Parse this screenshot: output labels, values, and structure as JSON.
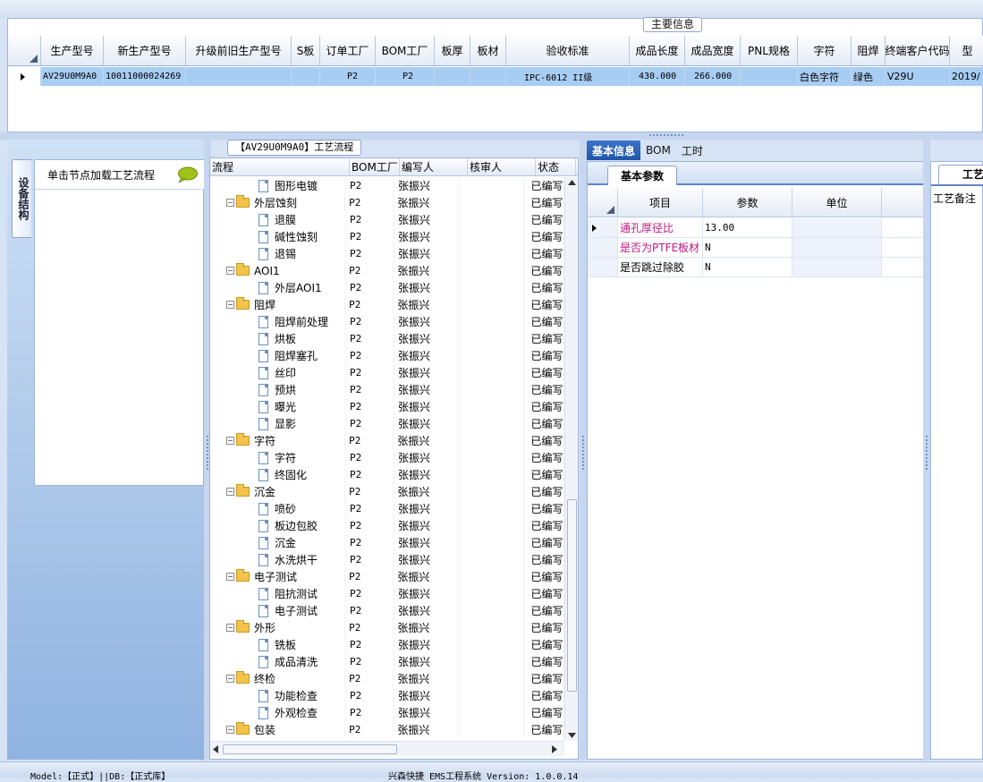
{
  "main_grid": {
    "group_title": "主要信息",
    "columns": [
      "生产型号",
      "新生产型号",
      "升级前旧生产型号",
      "S板",
      "订单工厂",
      "BOM工厂",
      "板厚",
      "板材",
      "验收标准",
      "成品长度",
      "成品宽度",
      "PNL规格",
      "字符",
      "阻焊",
      "终端客户代码",
      "型"
    ],
    "row": [
      "AV29U0M9A0",
      "10011000024269",
      "",
      "",
      "P2",
      "P2",
      "",
      "",
      "IPC-6012 II级",
      "430.000",
      "266.000",
      "",
      "白色字符",
      "绿色",
      "V29U",
      "2019/"
    ]
  },
  "left_panel": {
    "vertical_tab": "设备结构",
    "title": "单击节点加载工艺流程"
  },
  "process_panel": {
    "title": "【AV29U0M9A0】工艺流程",
    "columns": [
      "流程",
      "BOM工厂",
      "编写人",
      "核审人",
      "状态"
    ],
    "rows": [
      {
        "level": 2,
        "kind": "file",
        "name": "图形电镀",
        "factory": "P2",
        "author": "张振兴",
        "status": "已编写"
      },
      {
        "level": 1,
        "kind": "folder",
        "name": "外层蚀刻",
        "factory": "P2",
        "author": "张振兴",
        "status": "已编写"
      },
      {
        "level": 2,
        "kind": "file",
        "name": "退膜",
        "factory": "P2",
        "author": "张振兴",
        "status": "已编写"
      },
      {
        "level": 2,
        "kind": "file",
        "name": "碱性蚀刻",
        "factory": "P2",
        "author": "张振兴",
        "status": "已编写"
      },
      {
        "level": 2,
        "kind": "file",
        "name": "退锡",
        "factory": "P2",
        "author": "张振兴",
        "status": "已编写"
      },
      {
        "level": 1,
        "kind": "folder",
        "name": "AOI1",
        "factory": "P2",
        "author": "张振兴",
        "status": "已编写"
      },
      {
        "level": 2,
        "kind": "file",
        "name": "外层AOI1",
        "factory": "P2",
        "author": "张振兴",
        "status": "已编写"
      },
      {
        "level": 1,
        "kind": "folder",
        "name": "阻焊",
        "factory": "P2",
        "author": "张振兴",
        "status": "已编写"
      },
      {
        "level": 2,
        "kind": "file",
        "name": "阻焊前处理",
        "factory": "P2",
        "author": "张振兴",
        "status": "已编写"
      },
      {
        "level": 2,
        "kind": "file",
        "name": "烘板",
        "factory": "P2",
        "author": "张振兴",
        "status": "已编写"
      },
      {
        "level": 2,
        "kind": "file",
        "name": "阻焊塞孔",
        "factory": "P2",
        "author": "张振兴",
        "status": "已编写"
      },
      {
        "level": 2,
        "kind": "file",
        "name": "丝印",
        "factory": "P2",
        "author": "张振兴",
        "status": "已编写"
      },
      {
        "level": 2,
        "kind": "file",
        "name": "预烘",
        "factory": "P2",
        "author": "张振兴",
        "status": "已编写"
      },
      {
        "level": 2,
        "kind": "file",
        "name": "曝光",
        "factory": "P2",
        "author": "张振兴",
        "status": "已编写"
      },
      {
        "level": 2,
        "kind": "file",
        "name": "显影",
        "factory": "P2",
        "author": "张振兴",
        "status": "已编写"
      },
      {
        "level": 1,
        "kind": "folder",
        "name": "字符",
        "factory": "P2",
        "author": "张振兴",
        "status": "已编写"
      },
      {
        "level": 2,
        "kind": "file",
        "name": "字符",
        "factory": "P2",
        "author": "张振兴",
        "status": "已编写"
      },
      {
        "level": 2,
        "kind": "file",
        "name": "终固化",
        "factory": "P2",
        "author": "张振兴",
        "status": "已编写"
      },
      {
        "level": 1,
        "kind": "folder",
        "name": "沉金",
        "factory": "P2",
        "author": "张振兴",
        "status": "已编写"
      },
      {
        "level": 2,
        "kind": "file",
        "name": "喷砂",
        "factory": "P2",
        "author": "张振兴",
        "status": "已编写"
      },
      {
        "level": 2,
        "kind": "file",
        "name": "板边包胶",
        "factory": "P2",
        "author": "张振兴",
        "status": "已编写"
      },
      {
        "level": 2,
        "kind": "file",
        "name": "沉金",
        "factory": "P2",
        "author": "张振兴",
        "status": "已编写"
      },
      {
        "level": 2,
        "kind": "file",
        "name": "水洗烘干",
        "factory": "P2",
        "author": "张振兴",
        "status": "已编写"
      },
      {
        "level": 1,
        "kind": "folder",
        "name": "电子测试",
        "factory": "P2",
        "author": "张振兴",
        "status": "已编写"
      },
      {
        "level": 2,
        "kind": "file",
        "name": "阻抗测试",
        "factory": "P2",
        "author": "张振兴",
        "status": "已编写"
      },
      {
        "level": 2,
        "kind": "file",
        "name": "电子测试",
        "factory": "P2",
        "author": "张振兴",
        "status": "已编写"
      },
      {
        "level": 1,
        "kind": "folder",
        "name": "外形",
        "factory": "P2",
        "author": "张振兴",
        "status": "已编写"
      },
      {
        "level": 2,
        "kind": "file",
        "name": "铣板",
        "factory": "P2",
        "author": "张振兴",
        "status": "已编写"
      },
      {
        "level": 2,
        "kind": "file",
        "name": "成品清洗",
        "factory": "P2",
        "author": "张振兴",
        "status": "已编写"
      },
      {
        "level": 1,
        "kind": "folder",
        "name": "终检",
        "factory": "P2",
        "author": "张振兴",
        "status": "已编写"
      },
      {
        "level": 2,
        "kind": "file",
        "name": "功能检查",
        "factory": "P2",
        "author": "张振兴",
        "status": "已编写"
      },
      {
        "level": 2,
        "kind": "file",
        "name": "外观检查",
        "factory": "P2",
        "author": "张振兴",
        "status": "已编写"
      },
      {
        "level": 1,
        "kind": "folder",
        "name": "包装",
        "factory": "P2",
        "author": "张振兴",
        "status": "已编写"
      }
    ]
  },
  "info_tabs": [
    "基本信息",
    "BOM",
    "工时"
  ],
  "basic_params": {
    "tab": "基本参数",
    "columns": [
      "项目",
      "参数",
      "单位"
    ],
    "rows": [
      {
        "item": "通孔厚径比",
        "value": "13.00",
        "unit": "",
        "highlight": true
      },
      {
        "item": "是否为PTFE板材",
        "value": "N",
        "unit": "",
        "highlight": true
      },
      {
        "item": "是否跳过除胶",
        "value": "N",
        "unit": "",
        "highlight": false
      }
    ]
  },
  "right_panel": {
    "tab": "工艺",
    "label": "工艺备注"
  },
  "status_bar": {
    "left": "Model:【正式】||DB:【正式库】",
    "center": "兴森快捷 EMS工程系统 Version: 1.0.0.14"
  },
  "colors": {
    "selected_row": "#a8cdf2",
    "highlight_text": "#c0197f",
    "tab_active": "#2a63b6"
  }
}
